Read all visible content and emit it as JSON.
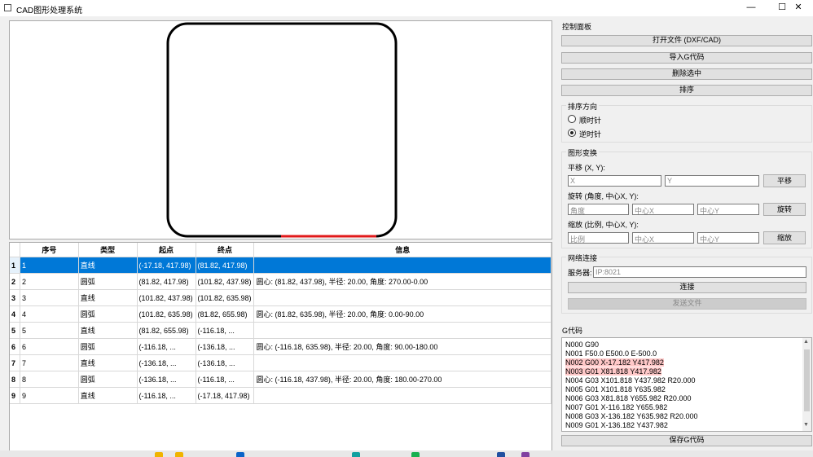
{
  "window": {
    "title": "CAD图形处理系统",
    "minimize": "—",
    "maximize": "☐",
    "close": "✕"
  },
  "table": {
    "headers": [
      "序号",
      "类型",
      "起点",
      "终点",
      "信息"
    ],
    "rows": [
      [
        "1",
        "直线",
        "(-17.18, 417.98)",
        "(81.82, 417.98)",
        ""
      ],
      [
        "2",
        "圆弧",
        "(81.82, 417.98)",
        "(101.82, 437.98)",
        "圆心: (81.82, 437.98), 半径: 20.00, 角度: 270.00-0.00"
      ],
      [
        "3",
        "直线",
        "(101.82, 437.98)",
        "(101.82, 635.98)",
        ""
      ],
      [
        "4",
        "圆弧",
        "(101.82, 635.98)",
        "(81.82, 655.98)",
        "圆心: (81.82, 635.98), 半径: 20.00, 角度: 0.00-90.00"
      ],
      [
        "5",
        "直线",
        "(81.82, 655.98)",
        "(-116.18, ...",
        ""
      ],
      [
        "6",
        "圆弧",
        "(-116.18, ...",
        "(-136.18, ...",
        "圆心: (-116.18, 635.98), 半径: 20.00, 角度: 90.00-180.00"
      ],
      [
        "7",
        "直线",
        "(-136.18, ...",
        "(-136.18, ...",
        ""
      ],
      [
        "8",
        "圆弧",
        "(-136.18, ...",
        "(-116.18, ...",
        "圆心: (-116.18, 437.98), 半径: 20.00, 角度: 180.00-270.00"
      ],
      [
        "9",
        "直线",
        "(-116.18, ...",
        "(-17.18, 417.98)",
        ""
      ]
    ],
    "selected_row": 1
  },
  "control_panel": {
    "title": "控制面板",
    "open_file": "打开文件 (DXF/CAD)",
    "import_gcode": "导入G代码",
    "delete_selected": "删除选中",
    "sort": "排序",
    "sort_direction": {
      "title": "排序方向",
      "clockwise": "顺时针",
      "counterclockwise": "逆时针",
      "selected": "逆时针"
    },
    "transform": {
      "title": "图形变换",
      "translate_label": "平移 (X, Y):",
      "translate_x_placeholder": "X",
      "translate_y_placeholder": "Y",
      "translate_button": "平移",
      "rotate_label": "旋转 (角度, 中心X, Y):",
      "rotate_angle_placeholder": "角度",
      "rotate_cx_placeholder": "中心X",
      "rotate_cy_placeholder": "中心Y",
      "rotate_button": "旋转",
      "scale_label": "缩放 (比例, 中心X, Y):",
      "scale_ratio_placeholder": "比例",
      "scale_cx_placeholder": "中心X",
      "scale_cy_placeholder": "中心Y",
      "scale_button": "缩放"
    },
    "network": {
      "title": "网络连接",
      "server_label": "服务器:",
      "server_placeholder": "IP:8021",
      "connect_button": "连接",
      "send_file_button": "发送文件"
    }
  },
  "gcode": {
    "title": "G代码",
    "lines": [
      "N000 G90",
      "N001 F50.0 E500.0 E-500.0",
      "N002 G00 X-17.182 Y417.982",
      "N003 G01 X81.818 Y417.982",
      "N004 G03 X101.818 Y437.982 R20.000",
      "N005 G01 X101.818 Y635.982",
      "N006 G03 X81.818 Y655.982 R20.000",
      "N007 G01 X-116.182 Y655.982",
      "N008 G03 X-136.182 Y635.982 R20.000",
      "N009 G01 X-136.182 Y437.982"
    ],
    "highlighted_lines": [
      2,
      3
    ],
    "save_button": "保存G代码"
  },
  "colors": {
    "selection": "#0078d7",
    "highlight_segment": "#e0191b",
    "shape_stroke": "#000000",
    "gcode_highlight": "#ffc8c8"
  }
}
